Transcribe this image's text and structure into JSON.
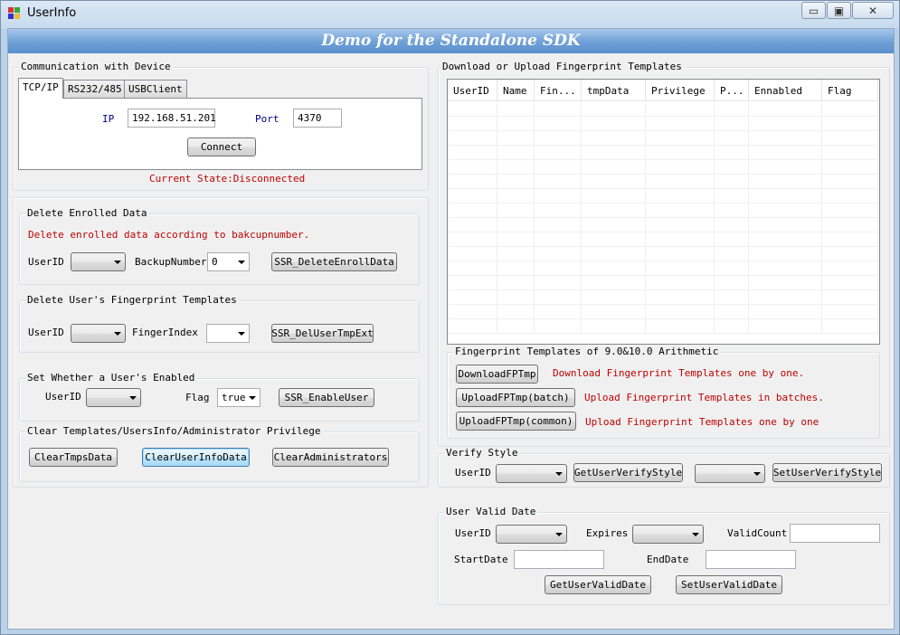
{
  "window": {
    "title": "UserInfo",
    "minimize": "▭",
    "maximize": "▣",
    "close": "✕"
  },
  "banner": "Demo for the Standalone SDK",
  "communication": {
    "group_label": "Communication with Device",
    "tabs": [
      "TCP/IP",
      "RS232/485",
      "USBClient"
    ],
    "ip_label": "IP",
    "ip_value": "192.168.51.201",
    "port_label": "Port",
    "port_value": "4370",
    "connect": "Connect",
    "state": "Current State:Disconnected"
  },
  "delete_enrolled": {
    "group_label": "Delete Enrolled Data",
    "hint": "Delete enrolled data according to bakcupnumber.",
    "userid_label": "UserID",
    "backup_label": "BackupNumber",
    "backup_value": "0",
    "button": "SSR_DeleteEnrollData"
  },
  "delete_fp": {
    "group_label": "Delete User's Fingerprint Templates",
    "userid_label": "UserID",
    "finger_label": "FingerIndex",
    "button": "SSR_DelUserTmpExt"
  },
  "enable": {
    "group_label": "Set Whether a User's Enabled",
    "userid_label": "UserID",
    "flag_label": "Flag",
    "flag_value": "true",
    "button": "SSR_EnableUser"
  },
  "clear": {
    "group_label": "Clear Templates/UsersInfo/Administrator Privilege",
    "btn_tmps": "ClearTmpsData",
    "btn_userinfo": "ClearUserInfoData",
    "btn_admin": "ClearAdministrators"
  },
  "templates": {
    "group_label": "Download or Upload Fingerprint Templates",
    "columns": [
      "UserID",
      "Name",
      "Fin...",
      "tmpData",
      "Privilege",
      "P...",
      "Ennabled",
      "Flag"
    ]
  },
  "arith": {
    "group_label": "Fingerprint Templates of 9.0&10.0 Arithmetic",
    "btn_download": "DownloadFPTmp",
    "hint_download": "Download Fingerprint Templates one by one.",
    "btn_upload_batch": "UploadFPTmp(batch)",
    "hint_upload_batch": "Upload Fingerprint Templates in batches.",
    "btn_upload_common": "UploadFPTmp(common)",
    "hint_upload_common": "Upload Fingerprint Templates one by one"
  },
  "verify": {
    "group_label": "Verify Style",
    "userid_label": "UserID",
    "btn_get": "GetUserVerifyStyle",
    "btn_set": "SetUserVerifyStyle"
  },
  "valid": {
    "group_label": "User Valid Date",
    "userid_label": "UserID",
    "expires_label": "Expires",
    "validcount_label": "ValidCount",
    "startdate_label": "StartDate",
    "enddate_label": "EndDate",
    "btn_get": "GetUserValidDate",
    "btn_set": "SetUserValidDate"
  },
  "colors": {
    "banner_top": "#a7c7ec",
    "banner_bottom": "#5b8fcd",
    "hint_red": "#c00000",
    "label_blue": "#000080"
  }
}
